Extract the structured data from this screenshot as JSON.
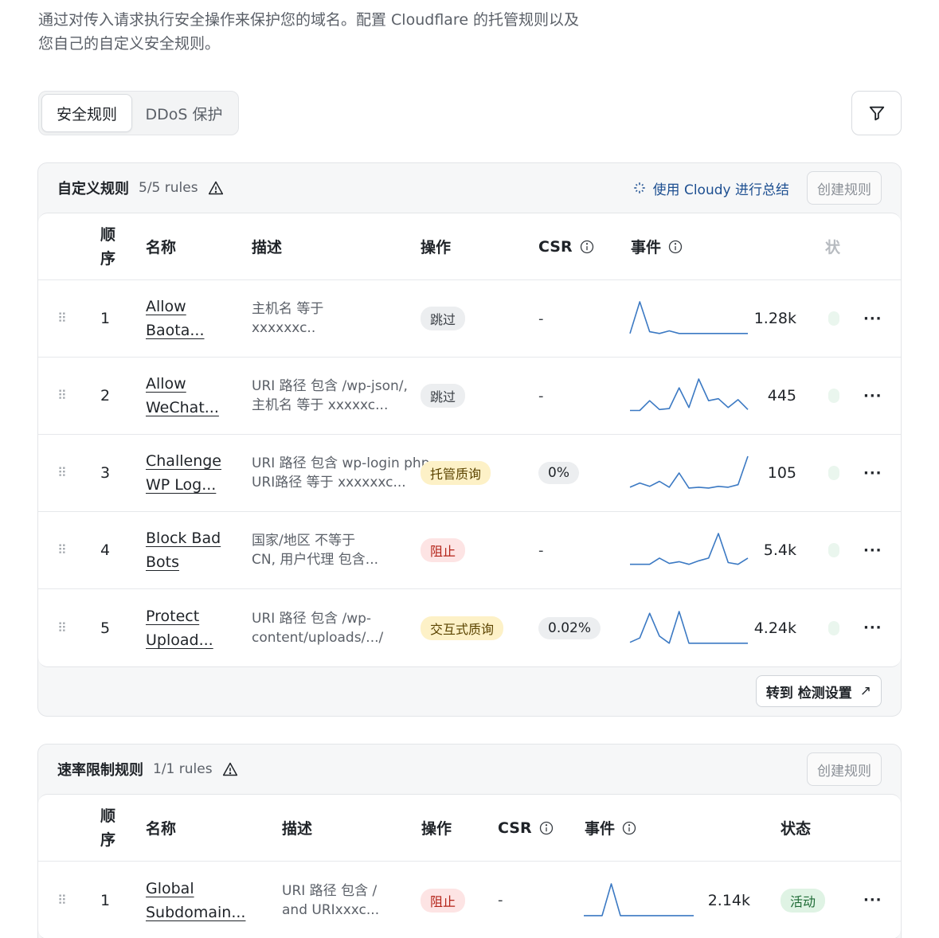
{
  "intro": {
    "line1": "通过对传入请求执行安全操作来保护您的域名。配置 Cloudflare 的托管规则以及",
    "line2": "您自己的自定义安全规则。"
  },
  "tabs": [
    {
      "label": "安全规则",
      "active": true
    },
    {
      "label": "DDoS 保护",
      "active": false
    }
  ],
  "filter_icon": "filter-icon",
  "custom_rules": {
    "title": "自定义规则",
    "count": "5/5 rules",
    "cloudy_label": "使用 Cloudy 进行总结",
    "create_label": "创建规则",
    "headers": {
      "order_1": "顺",
      "order_2": "序",
      "name": "名称",
      "description": "描述",
      "action": "操作",
      "csr": "CSR",
      "events": "事件",
      "status": "状"
    },
    "rows": [
      {
        "order": "1",
        "name_1": "Allow",
        "name_2": "Baota...",
        "desc_1": "主机名 等于",
        "desc_2": "xxxxxxc..",
        "action": "跳过",
        "action_kind": "skip",
        "csr": "-",
        "events": "1.28k",
        "spark": [
          2,
          38,
          4,
          2,
          5,
          2,
          2,
          2,
          2,
          2,
          2,
          2,
          2
        ]
      },
      {
        "order": "2",
        "name_1": "Allow",
        "name_2": "WeChat...",
        "desc_1": "URI 路径 包含 /wp-json/,",
        "desc_2": "主机名 等于 xxxxxc...",
        "action": "跳过",
        "action_kind": "skip",
        "csr": "-",
        "events": "445",
        "spark": [
          2,
          2,
          12,
          3,
          4,
          25,
          5,
          34,
          12,
          14,
          5,
          13,
          3
        ]
      },
      {
        "order": "3",
        "name_1": "Challenge",
        "name_2": "WP Log...",
        "desc_1": "URI 路径 包含 wp-login php,",
        "desc_2": "URI路径 等于 xxxxxxc...",
        "action": "托管质询",
        "action_kind": "managed",
        "csr": "0%",
        "events": "105",
        "spark": [
          3,
          8,
          4,
          10,
          3,
          20,
          2,
          3,
          2,
          4,
          3,
          6,
          40
        ]
      },
      {
        "order": "4",
        "name_1": "Block Bad",
        "name_2": "Bots",
        "desc_1": "国家/地区 不等于",
        "desc_2": "CN, 用户代理 包含...",
        "action": "阻止",
        "action_kind": "block",
        "csr": "-",
        "events": "5.4k",
        "spark": [
          3,
          3,
          3,
          10,
          4,
          6,
          3,
          7,
          10,
          38,
          5,
          3,
          10
        ]
      },
      {
        "order": "5",
        "name_1": "Protect",
        "name_2": "Upload...",
        "desc_1": "URI 路径 包含 /wp-",
        "desc_2": "content/uploads/.../",
        "action": "交互式质询",
        "action_kind": "interactive",
        "csr": "0.02%",
        "events": "4.24k",
        "spark": [
          3,
          8,
          36,
          10,
          2,
          38,
          2,
          2,
          2,
          2,
          2,
          2,
          2
        ]
      }
    ],
    "goto_label": "转到 检测设置"
  },
  "rate_rules": {
    "title": "速率限制规则",
    "count": "1/1 rules",
    "create_label": "创建规则",
    "headers": {
      "order_1": "顺",
      "order_2": "序",
      "name": "名称",
      "description": "描述",
      "action": "操作",
      "csr": "CSR",
      "events": "事件",
      "status": "状态"
    },
    "rows": [
      {
        "order": "1",
        "name_1": "Global",
        "name_2": "Subdomain...",
        "desc_1": "URI 路径 包含 /",
        "desc_2": "and URIxxxc...",
        "action": "阻止",
        "action_kind": "block",
        "csr": "-",
        "events": "2.14k",
        "status": "活动",
        "spark": [
          2,
          2,
          2,
          40,
          2,
          2,
          2,
          2,
          2,
          2,
          2,
          2,
          2
        ]
      }
    ]
  },
  "colors": {
    "accent": "#1d4f91",
    "spark": "#3b79c3"
  }
}
